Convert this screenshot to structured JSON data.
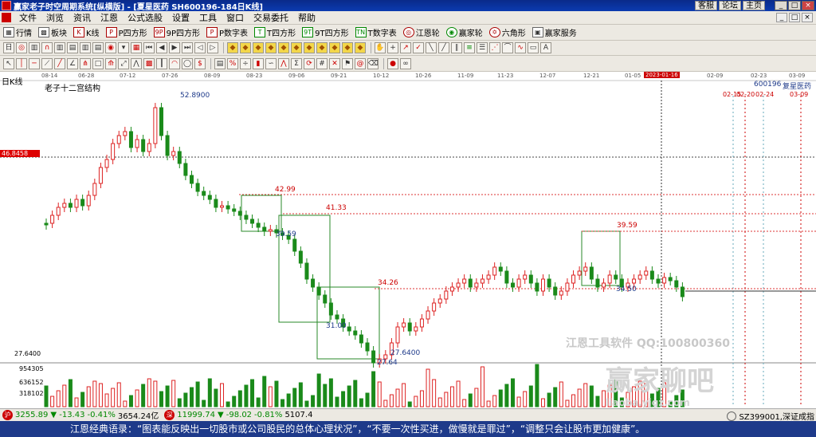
{
  "titlebar": {
    "title": "赢家老子时空周期系统[纵横版] - [夏星医药  SH600196-184日K线]",
    "links": [
      "客服",
      "论坛",
      "主页"
    ],
    "window_buttons": [
      "_",
      "□",
      "×"
    ]
  },
  "menubar": {
    "items": [
      "文件",
      "浏览",
      "资讯",
      "江恩",
      "公式选股",
      "设置",
      "工具",
      "窗口",
      "交易委托",
      "帮助"
    ],
    "mdi_buttons": [
      "_",
      "□",
      "×"
    ]
  },
  "toolbar1": {
    "items": [
      {
        "icon": "grid-icon",
        "glyph": "▦",
        "label": "行情"
      },
      {
        "icon": "blocks-icon",
        "glyph": "▩",
        "label": "板块"
      },
      {
        "icon": "kline-icon",
        "glyph": "K",
        "label": "K线"
      },
      {
        "icon": "p-square-icon",
        "glyph": "P",
        "label": "P四方形"
      },
      {
        "icon": "9p-square-icon",
        "glyph": "9P",
        "label": "9P四方形"
      },
      {
        "icon": "p-numtable-icon",
        "glyph": "P",
        "label": "P数字表"
      },
      {
        "icon": "t-square-icon",
        "glyph": "T",
        "label": "T四方形"
      },
      {
        "icon": "9t-square-icon",
        "glyph": "9T",
        "label": "9T四方形"
      },
      {
        "icon": "t-numtable-icon",
        "glyph": "TN",
        "label": "T数字表"
      },
      {
        "icon": "gann-wheel-icon",
        "glyph": "◎",
        "label": "江恩轮"
      },
      {
        "icon": "winner-wheel-icon",
        "glyph": "◉",
        "label": "赢家轮"
      },
      {
        "icon": "hexagon-icon",
        "glyph": "✡",
        "label": "六角形"
      },
      {
        "icon": "winner-service-icon",
        "glyph": "▣",
        "label": "赢家服务"
      }
    ]
  },
  "chart": {
    "period_label": "日K线",
    "study_label": "老子十二宫结构",
    "stock_code": "600196",
    "stock_name": "复星医药",
    "price_marker": "46.8458",
    "low_marker": "27.6400",
    "dates": [
      "08-14",
      "06-28",
      "07-12",
      "07-26",
      "08-09",
      "08-23",
      "09-06",
      "09-21",
      "10-12",
      "10-26",
      "11-09",
      "11-23",
      "12-07",
      "12-21",
      "01-05",
      "2023-01-16",
      "02-09",
      "02-23",
      "03-09"
    ],
    "future_dates": [
      "02-15",
      "02-20",
      "02-24",
      "03-09"
    ],
    "annotations": {
      "high": "52.8900",
      "low": "27.6400",
      "low2": "27.64",
      "l1": "42.99",
      "l2": "39.59",
      "l3": "41.33",
      "l4": "31.00",
      "l5": "34.26",
      "l6": "39.59",
      "l7": "34.50"
    },
    "volume_labels": [
      "954305",
      "636152",
      "318102"
    ],
    "watermark_1": "江恩工具软件  QQ:100800360",
    "watermark_2": "赢家聊吧",
    "watermark_3": "liaoba.yjgz.com"
  },
  "statusbar": {
    "sh_index": {
      "icon": "沪",
      "value": "3255.89",
      "change": "▼ -13.43",
      "pct": "-0.41%",
      "amount": "3654.24亿"
    },
    "sz_index": {
      "icon": "深",
      "value": "11999.74",
      "change": "▼ -98.02",
      "pct": "-0.81%",
      "amount": "5107.4"
    },
    "right_text": "SZ399001,深证成指"
  },
  "quote": {
    "text": "江恩经典语录：“图表能反映出一切股市或公司股民的总体心理状况”，“不要一次性买进，做慢就是罪过”，“调整只会让股市更加健康”。"
  }
}
